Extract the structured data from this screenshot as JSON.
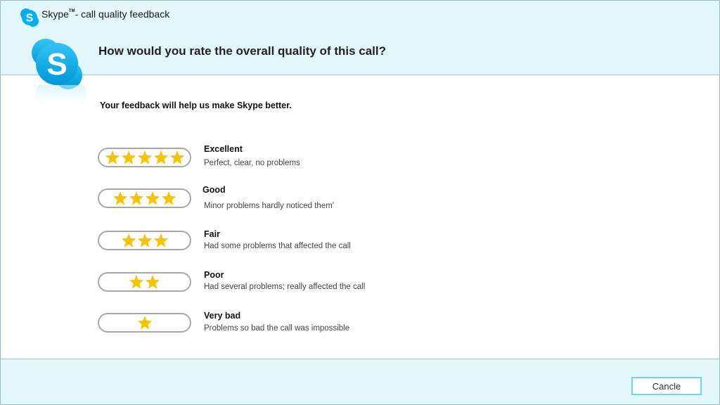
{
  "window": {
    "title": "Skype",
    "title_trademark": "TM",
    "title_suffix": "- call quality feedback"
  },
  "header": {
    "question": "How would you rate the overall quality of this call?"
  },
  "main": {
    "subtitle": "Your feedback will help us make Skype better.",
    "options": [
      {
        "stars": 5,
        "label": "Excellent",
        "description": "Perfect, clear, no problems"
      },
      {
        "stars": 4,
        "label": "Good",
        "description": "Minor problems hardly noticed them'"
      },
      {
        "stars": 3,
        "label": "Fair",
        "description": "Had some problems that affected the call"
      },
      {
        "stars": 2,
        "label": "Poor",
        "description": "Had several problems; really affected the call"
      },
      {
        "stars": 1,
        "label": "Very bad",
        "description": "Problems so bad the call was impossible"
      }
    ]
  },
  "footer": {
    "cancel_label": "Cancle"
  },
  "colors": {
    "header_bg": "#e1f7fb",
    "skype_blue": "#00aff0",
    "star": "#f5c400",
    "cancel_border": "#7fd0e0"
  },
  "icons": {
    "title_icon": "skype-logo-icon",
    "big_logo": "skype-logo-icon",
    "star": "star-icon"
  }
}
